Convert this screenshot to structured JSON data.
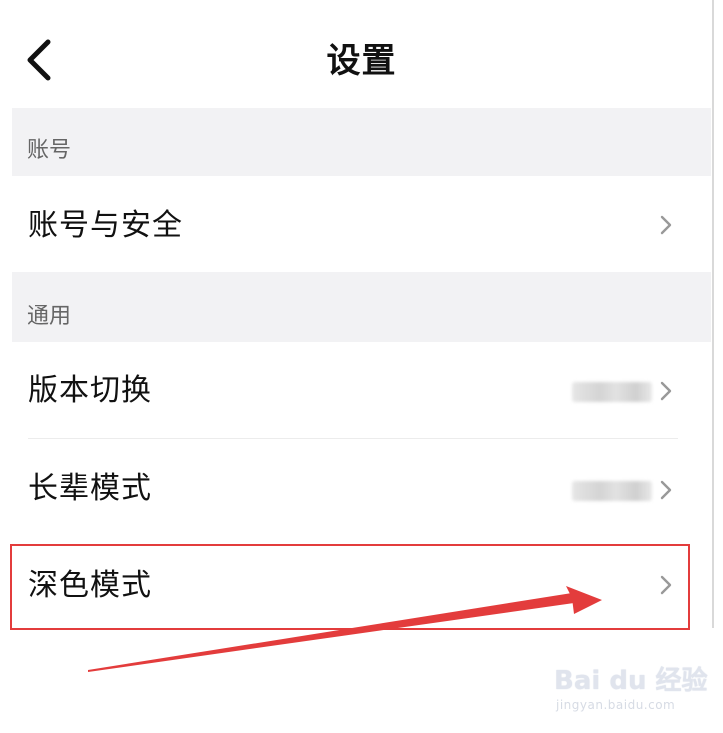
{
  "header": {
    "title": "设置",
    "back_icon": "chevron-left-icon"
  },
  "sections": [
    {
      "title": "账号",
      "items": [
        {
          "label": "账号与安全",
          "value_blurred": false
        }
      ]
    },
    {
      "title": "通用",
      "items": [
        {
          "label": "版本切换",
          "value_blurred": true
        },
        {
          "label": "长辈模式",
          "value_blurred": true
        },
        {
          "label": "深色模式",
          "value_blurred": false,
          "highlighted": true
        }
      ]
    }
  ],
  "annotation": {
    "highlight_color": "#e33c3c",
    "arrow_color": "#e33c3c"
  },
  "watermark": {
    "main": "Bai du 经验",
    "sub": "jingyan.baidu.com"
  },
  "colors": {
    "section_bg": "#f2f2f4",
    "text": "#111111",
    "muted": "#666666",
    "chevron": "#999999"
  }
}
